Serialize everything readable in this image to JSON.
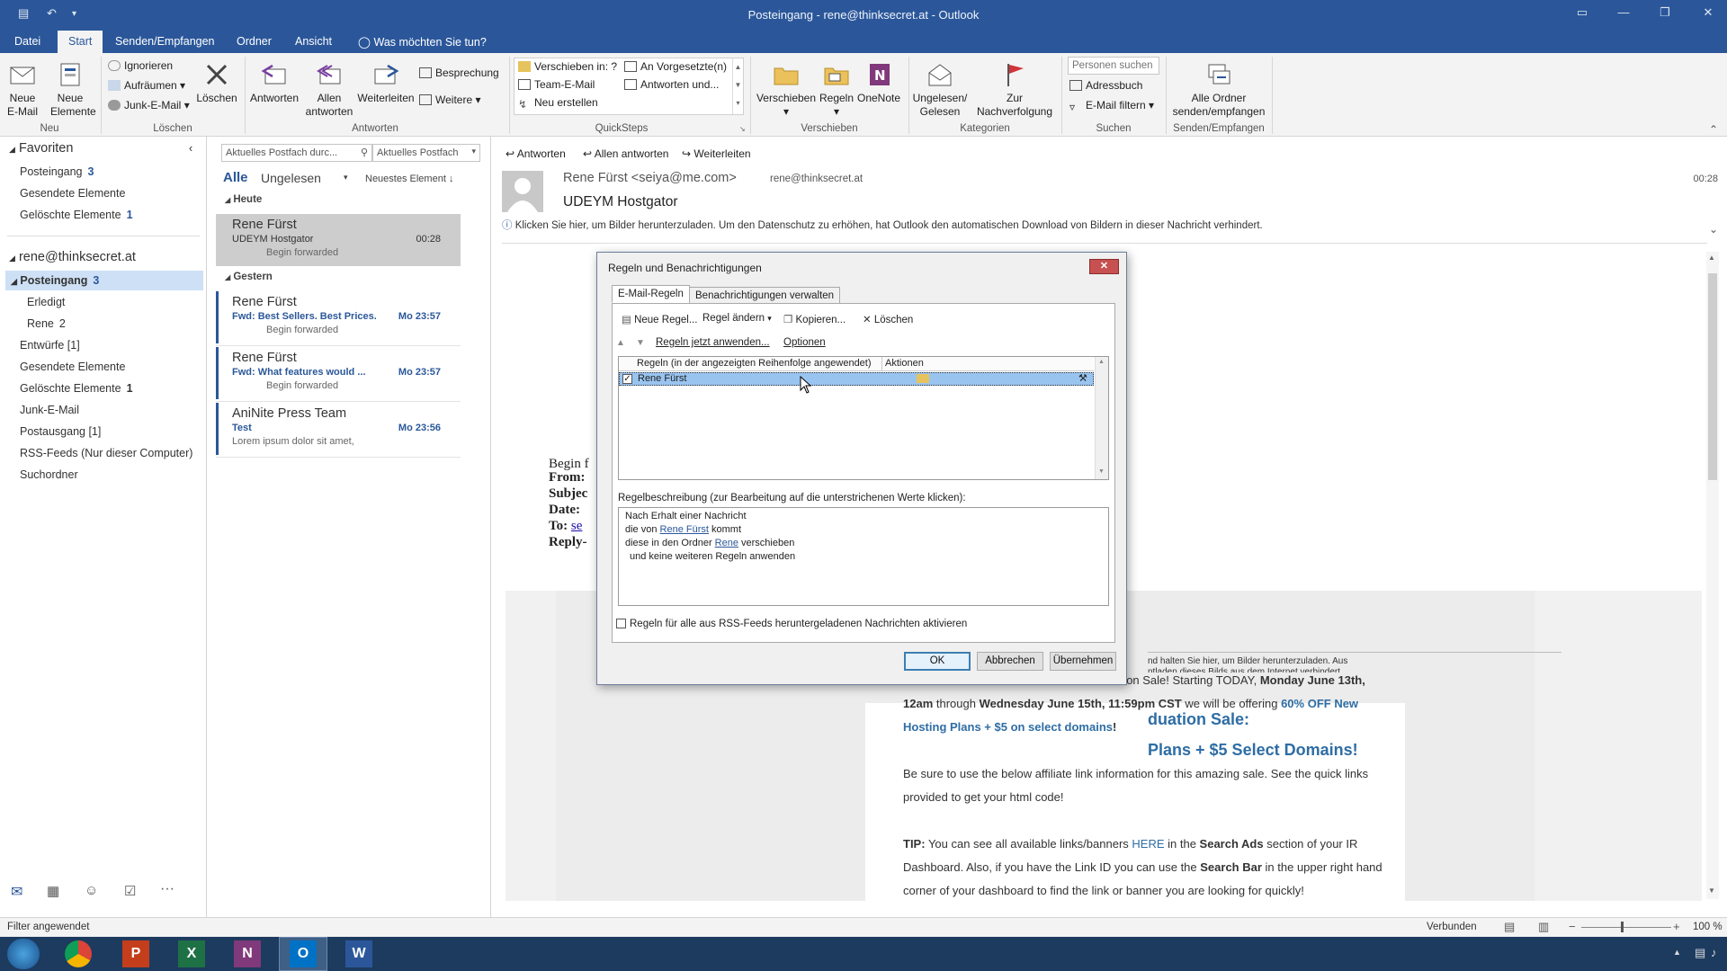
{
  "window": {
    "title": "Posteingang - rene@thinksecret.at - Outlook"
  },
  "ribbon_tabs": [
    "Datei",
    "Start",
    "Senden/Empfangen",
    "Ordner",
    "Ansicht"
  ],
  "tell_me": "Was möchten Sie tun?",
  "ribbon": {
    "neu": {
      "label": "Neu",
      "new_email": "Neue\nE-Mail",
      "new_items": "Neue\nElemente"
    },
    "loeschen": {
      "label": "Löschen",
      "ignore": "Ignorieren",
      "cleanup": "Aufräumen",
      "junk": "Junk-E-Mail",
      "delete": "Löschen"
    },
    "antworten": {
      "label": "Antworten",
      "reply": "Antworten",
      "reply_all": "Allen\nantworten",
      "forward": "Weiterleiten",
      "meeting": "Besprechung",
      "more": "Weitere"
    },
    "quicksteps": {
      "label": "QuickSteps",
      "items": [
        "Verschieben in: ?",
        "Team-E-Mail",
        "Neu erstellen",
        "An Vorgesetzte(n)",
        "Antworten und..."
      ]
    },
    "verschieben": {
      "label": "Verschieben",
      "move": "Verschieben",
      "rules": "Regeln",
      "onenote": "OneNote"
    },
    "kategorien": {
      "label": "Kategorien",
      "unread": "Ungelesen/\nGelesen",
      "followup": "Zur\nNachverfolgung"
    },
    "suchen": {
      "label": "Suchen",
      "people_placeholder": "Personen suchen",
      "addressbook": "Adressbuch",
      "filter": "E-Mail filtern"
    },
    "sendrecv": {
      "label": "Senden/Empfangen",
      "all": "Alle Ordner\nsenden/empfangen"
    }
  },
  "nav": {
    "favorites": "Favoriten",
    "fav_items": [
      {
        "label": "Posteingang",
        "count": "3"
      },
      {
        "label": "Gesendete Elemente",
        "count": ""
      },
      {
        "label": "Gelöschte Elemente",
        "count": "1"
      }
    ],
    "account": "rene@thinksecret.at",
    "inbox": {
      "label": "Posteingang",
      "count": "3"
    },
    "subfolders": [
      {
        "label": "Erledigt",
        "count": ""
      },
      {
        "label": "Rene",
        "count": "2"
      }
    ],
    "folders": [
      {
        "label": "Entwürfe [1]",
        "count": ""
      },
      {
        "label": "Gesendete Elemente",
        "count": ""
      },
      {
        "label": "Gelöschte Elemente",
        "count": "1"
      },
      {
        "label": "Junk-E-Mail",
        "count": ""
      },
      {
        "label": "Postausgang [1]",
        "count": ""
      },
      {
        "label": "RSS-Feeds (Nur dieser Computer)",
        "count": ""
      },
      {
        "label": "Suchordner",
        "count": ""
      }
    ]
  },
  "list": {
    "search_placeholder": "Aktuelles Postfach durc...",
    "scope": "Aktuelles Postfach",
    "filter_all": "Alle",
    "filter_unread": "Ungelesen",
    "sort": "Neuestes Element",
    "group_today": "Heute",
    "group_yesterday": "Gestern",
    "messages": [
      {
        "sender": "Rene Fürst",
        "subject": "UDEYM Hostgator",
        "time": "00:28",
        "preview": "Begin forwarded"
      },
      {
        "sender": "Rene Fürst",
        "subject": "Fwd: Best Sellers. Best Prices.",
        "time": "Mo 23:57",
        "preview": "Begin forwarded"
      },
      {
        "sender": "Rene Fürst",
        "subject": "Fwd: What features would ...",
        "time": "Mo 23:57",
        "preview": "Begin forwarded"
      },
      {
        "sender": "AniNite Press Team",
        "subject": "Test",
        "time": "Mo 23:56",
        "preview": "Lorem ipsum dolor sit amet,"
      }
    ]
  },
  "reading": {
    "actions": [
      "Antworten",
      "Allen antworten",
      "Weiterleiten"
    ],
    "from": "Rene Fürst <seiya@me.com>",
    "to": "rene@thinksecret.at",
    "time": "00:28",
    "subject": "UDEYM Hostgator",
    "info": "Klicken Sie hier, um Bilder herunterzuladen. Um den Datenschutz zu erhöhen, hat Outlook den automatischen Download von Bildern in dieser Nachricht verhindert.",
    "fwd_begin": "Begin f",
    "hdr_from": "From:",
    "hdr_subject": "Subjec",
    "hdr_date": "Date:",
    "hdr_to": "To:",
    "hdr_to_link": "se",
    "hdr_reply": "Reply-",
    "img_note_1": "nd halten Sie hier, um Bilder herunterzuladen. Aus",
    "img_note_2": "ntladen dieses Bilds aus dem Internet verhindert.",
    "headline1": "duation Sale:",
    "headline2": "Plans + $5 Select Domains!",
    "para1_a": "duation Sale! Starting TODAY, ",
    "para1_b": "Monday June 13th, 12am",
    "para1_c": " through ",
    "para1_d": "Wednesday June 15th, 11:59pm CST",
    "para1_e": " we will be offering ",
    "para1_f": "60% OFF New Hosting Plans + $5 on select domains",
    "para1_g": "!",
    "para2": "Be sure to use the below affiliate link information for this amazing sale. See the quick links provided to get your html code!",
    "tip_label": "TIP:",
    "tip_a": " You can see all available links/banners ",
    "tip_here": "HERE",
    "tip_b": " in the ",
    "tip_search_ads": "Search Ads",
    "tip_c": " section of your IR Dashboard. Also, if you have the Link ID you can use the ",
    "tip_search_bar": "Search Bar",
    "tip_d": " in the upper right hand corner of your dashboard to find the link or banner you are looking for quickly!"
  },
  "dialog": {
    "title": "Regeln und Benachrichtigungen",
    "tab_rules": "E-Mail-Regeln",
    "tab_alerts": "Benachrichtigungen verwalten",
    "new_rule": "Neue Regel...",
    "change_rule": "Regel ändern",
    "copy": "Kopieren...",
    "delete": "Löschen",
    "apply_now": "Regeln jetzt anwenden...",
    "options": "Optionen",
    "col_rules": "Regeln (in der angezeigten Reihenfolge angewendet)",
    "col_actions": "Aktionen",
    "rule_name": "Rene Fürst",
    "desc_label": "Regelbeschreibung (zur Bearbeitung auf die unterstrichenen Werte klicken):",
    "desc_line1": "Nach Erhalt einer Nachricht",
    "desc_line2_a": "die von ",
    "desc_line2_link": "Rene Fürst",
    "desc_line2_b": " kommt",
    "desc_line3_a": "diese in den Ordner ",
    "desc_line3_link": "Rene",
    "desc_line3_b": " verschieben",
    "desc_line4": "und keine weiteren Regeln anwenden",
    "rss_checkbox": "Regeln für alle aus RSS-Feeds heruntergeladenen Nachrichten aktivieren",
    "ok": "OK",
    "cancel": "Abbrechen",
    "apply": "Übernehmen"
  },
  "status": {
    "filter": "Filter angewendet",
    "connected": "Verbunden",
    "zoom": "100 %"
  },
  "colors": {
    "accent": "#2b579a",
    "link_blue": "#2e6da4"
  }
}
